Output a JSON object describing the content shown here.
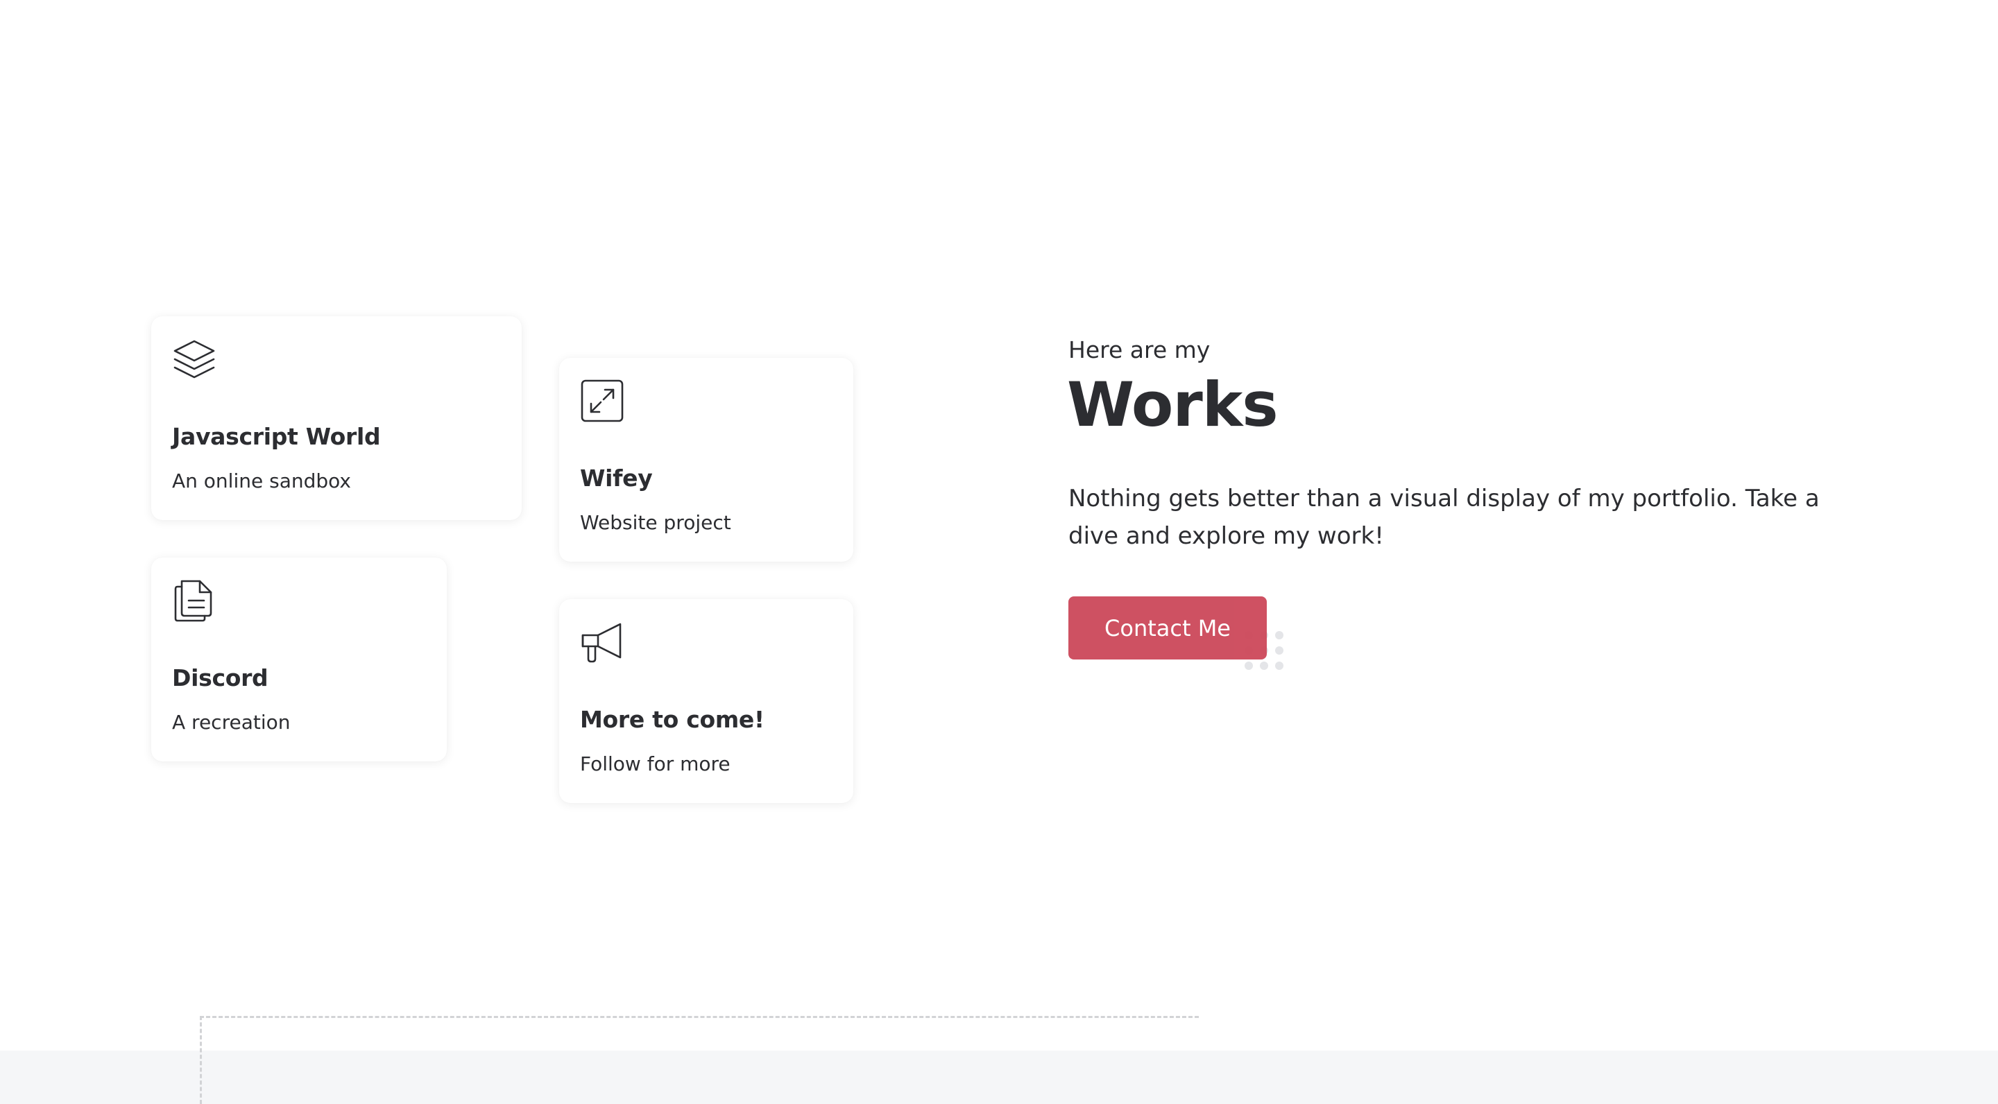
{
  "works": {
    "cards": [
      {
        "icon": "layers-icon",
        "title": "Javascript World",
        "subtitle": "An online sandbox"
      },
      {
        "icon": "maximize-icon",
        "title": "Wifey",
        "subtitle": "Website project"
      },
      {
        "icon": "document-icon",
        "title": "Discord",
        "subtitle": "A recreation"
      },
      {
        "icon": "megaphone-icon",
        "title": "More to come!",
        "subtitle": "Follow for more"
      }
    ]
  },
  "hero": {
    "eyebrow": "Here are my",
    "headline": "Works",
    "description": "Nothing gets better than a visual display of my portfolio. Take a dive and explore my work!",
    "cta_label": "Contact Me"
  },
  "colors": {
    "accent": "#cd4a5c",
    "text": "#2c2d31",
    "footer_bg": "#f5f6f8"
  }
}
